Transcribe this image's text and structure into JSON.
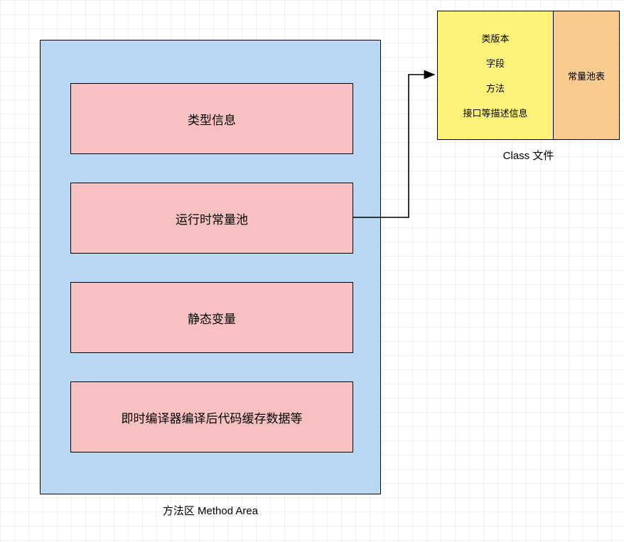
{
  "methodArea": {
    "label": "方法区 Method Area",
    "boxes": [
      "类型信息",
      "运行时常量池",
      "静态变量",
      "即时编译器编译后代码缓存数据等"
    ]
  },
  "classFile": {
    "label": "Class 文件",
    "left": [
      "类版本",
      "字段",
      "方法",
      "接口等描述信息"
    ],
    "right": "常量池表"
  }
}
